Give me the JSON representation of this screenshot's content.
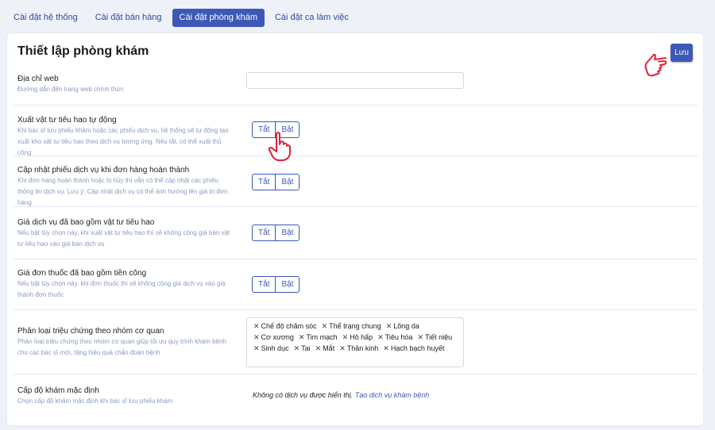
{
  "tabs": [
    {
      "label": "Cài đặt hệ thống"
    },
    {
      "label": "Cài đặt bán hàng"
    },
    {
      "label": "Cài đặt phòng khám"
    },
    {
      "label": "Cài đặt ca làm việc"
    }
  ],
  "page_title": "Thiết lập phòng khám",
  "save_label": "Lưu",
  "settings": [
    {
      "label": "Địa chỉ web",
      "desc": "Đường dẫn đến trang web chính thức"
    },
    {
      "label": "Xuất vật tư tiêu hao tự động",
      "desc": "Khi bác sĩ lưu phiếu khám hoặc các phiếu dịch vụ, hệ thống sẽ tự động tạo xuất kho vật tư tiêu hao theo dịch vụ tương ứng. Nếu tắt, có thể xuất thủ công"
    },
    {
      "label": "Cập nhật phiếu dịch vụ khi đơn hàng hoàn thành",
      "desc": "Khi đơn hàng hoàn thành hoặc bị hủy thì vẫn có thể cập nhật các phiếu thông tin dịch vụ. Lưu ý: Cập nhật dịch vụ có thể ảnh hưởng lên giá trị đơn hàng"
    },
    {
      "label": "Giá dịch vụ đã bao gồm vật tư tiêu hao",
      "desc": "Nếu bật tùy chọn này, khi xuất vật tư tiêu hao thì sẽ không cộng giá bán vật tư tiêu hao vào giá bán dịch vụ"
    },
    {
      "label": "Giá đơn thuốc đã bao gồm tiền công",
      "desc": "Nếu bật tùy chọn này, khi đơn thuốc thì sẽ không cộng giá dịch vụ vào giá thành đơn thuốc"
    },
    {
      "label": "Phân loại triệu chứng theo nhóm cơ quan",
      "desc": "Phân loại triệu chứng theo nhóm cơ quan giúp tối ưu quy trình khám bệnh cho các bác sĩ mới, tăng hiệu quả chẩn đoán bệnh"
    },
    {
      "label": "Cấp độ khám mặc định",
      "desc": "Chọn cấp độ khám mặc định khi bác sĩ lưu phiếu khám"
    }
  ],
  "toggle": {
    "off_label": "Tắt",
    "on_label": "Bật"
  },
  "tags": [
    "Chế độ chăm sóc",
    "Thể trạng chung",
    "Lông da",
    "Cơ xương",
    "Tim mạch",
    "Hô hấp",
    "Tiêu hóa",
    "Tiết niệu",
    "Sinh dục",
    "Tai",
    "Mắt",
    "Thần kinh",
    "Hạch bạch huyết"
  ],
  "empty": {
    "text": "Không có dịch vụ được hiển thị.",
    "link": "Tạo dịch vụ khám bệnh"
  },
  "colors": {
    "accent": "#3d58b7",
    "hint": "#8a9bbf",
    "pointer": "#e0213a"
  },
  "icons": {
    "pointer_left": "hand-pointing-left-icon",
    "pointer_up": "hand-pointing-up-icon",
    "remove": "close-icon"
  }
}
